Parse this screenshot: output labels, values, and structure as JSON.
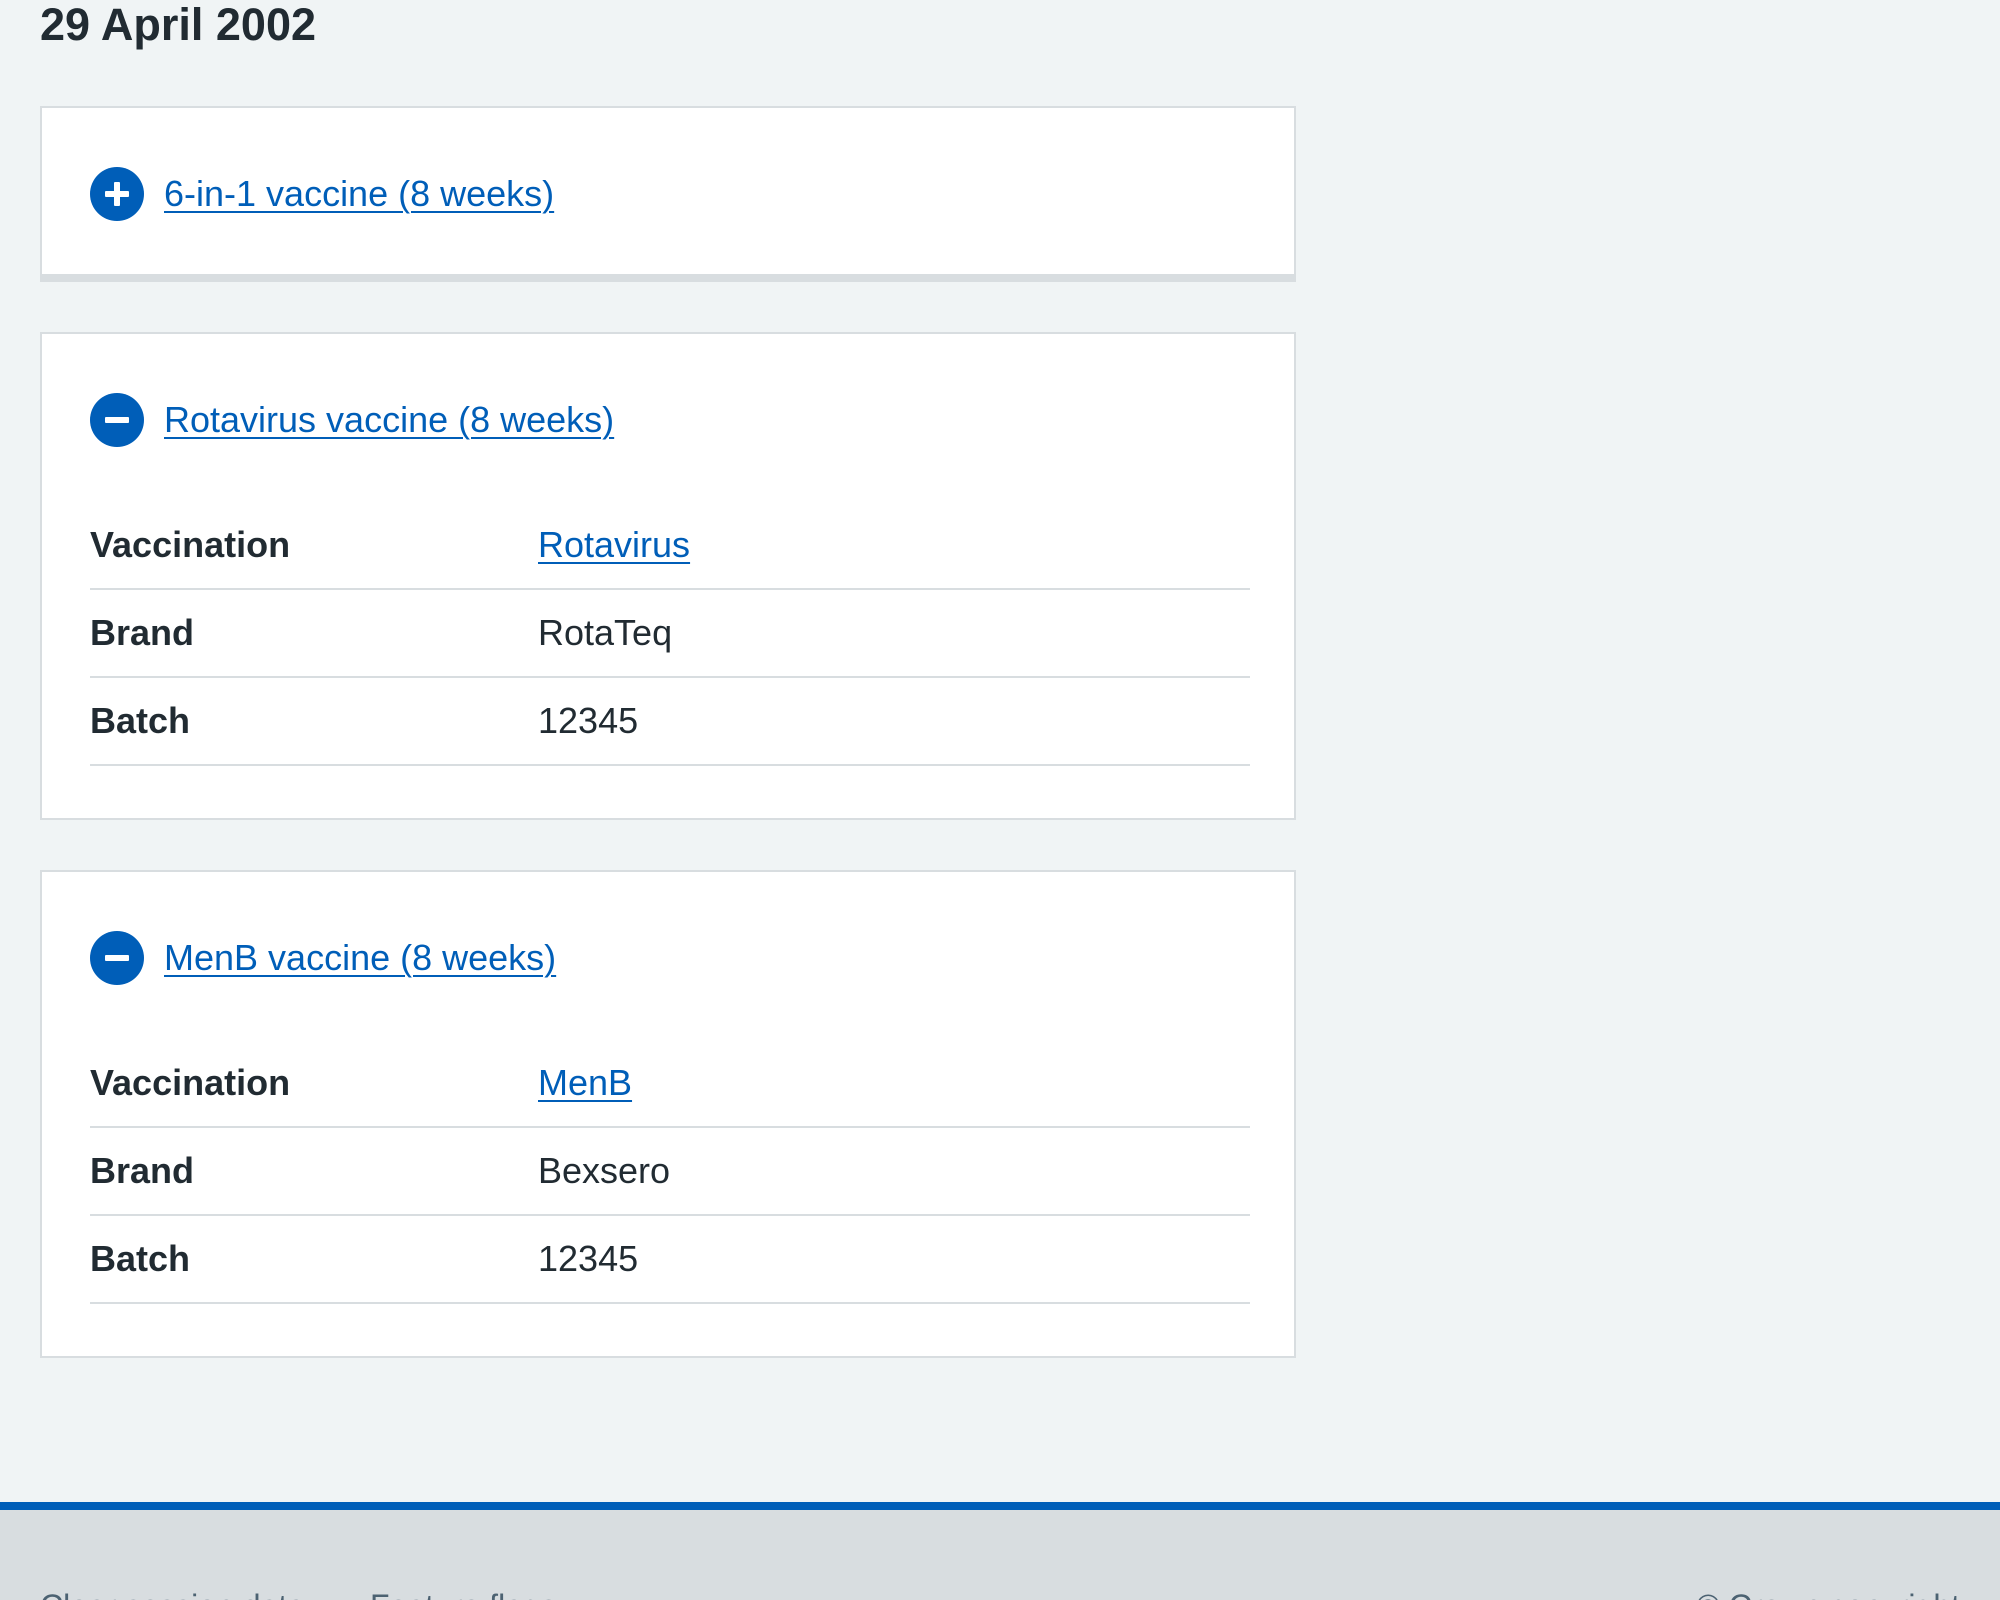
{
  "page": {
    "date_heading": "29 April 2002"
  },
  "vaccinations": [
    {
      "title": "6-in-1 vaccine (8 weeks)",
      "expanded": false,
      "icon": "plus-icon"
    },
    {
      "title": "Rotavirus vaccine (8 weeks)",
      "expanded": true,
      "icon": "minus-icon",
      "rows": [
        {
          "key": "Vaccination",
          "value": "Rotavirus",
          "is_link": true
        },
        {
          "key": "Brand",
          "value": "RotaTeq",
          "is_link": false
        },
        {
          "key": "Batch",
          "value": "12345",
          "is_link": false
        }
      ]
    },
    {
      "title": "MenB vaccine (8 weeks)",
      "expanded": true,
      "icon": "minus-icon",
      "rows": [
        {
          "key": "Vaccination",
          "value": "MenB",
          "is_link": true
        },
        {
          "key": "Brand",
          "value": "Bexsero",
          "is_link": false
        },
        {
          "key": "Batch",
          "value": "12345",
          "is_link": false
        }
      ]
    }
  ],
  "footer": {
    "links": [
      "Clear session data",
      "Feature flags"
    ],
    "copyright": "© Crown copyright"
  },
  "colors": {
    "page_background": "#f0f4f5",
    "link_blue": "#005eb8",
    "text": "#212b32",
    "border": "#d8dde0",
    "footer_background": "#d8dde0",
    "footer_text": "#4c6272"
  }
}
